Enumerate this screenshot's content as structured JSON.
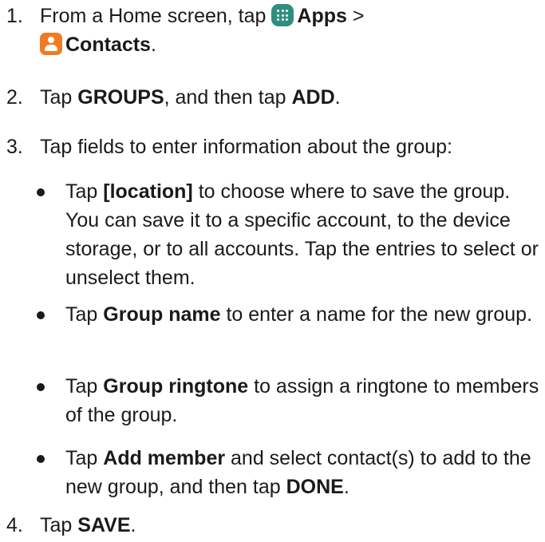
{
  "steps": [
    {
      "number": "1.",
      "line1_prefix": "From a Home screen, tap",
      "apps_label": "Apps",
      "separator": ">",
      "contacts_label": "Contacts",
      "period": "."
    },
    {
      "number": "2.",
      "prefix": "Tap ",
      "groups_label": "GROUPS",
      "middle": ", and then tap ",
      "add_label": "ADD",
      "period": "."
    },
    {
      "number": "3.",
      "text": "Tap fields to enter information about the group:",
      "bullets": [
        {
          "prefix": "Tap ",
          "bold": "[location]",
          "rest": " to choose where to save the group. You can save it to a specific account, to the device storage, or to all accounts. Tap the entries to select or unselect them."
        },
        {
          "prefix": "Tap ",
          "bold": "Group name",
          "rest": " to enter a name for the new group."
        },
        {
          "prefix": "Tap ",
          "bold": "Group ringtone",
          "rest": " to assign a ringtone to members of the group."
        },
        {
          "prefix": "Tap ",
          "bold": "Add member",
          "rest": " and select contact(s) to add to the new group, and then tap ",
          "bold2": "DONE",
          "end": "."
        }
      ]
    },
    {
      "number": "4.",
      "prefix": "Tap ",
      "save_label": "SAVE",
      "period": "."
    }
  ],
  "icons": {
    "apps": "apps-grid-icon",
    "contacts": "contacts-person-icon",
    "apps_color": "#2f8f7f",
    "contacts_color": "#f07b22"
  }
}
